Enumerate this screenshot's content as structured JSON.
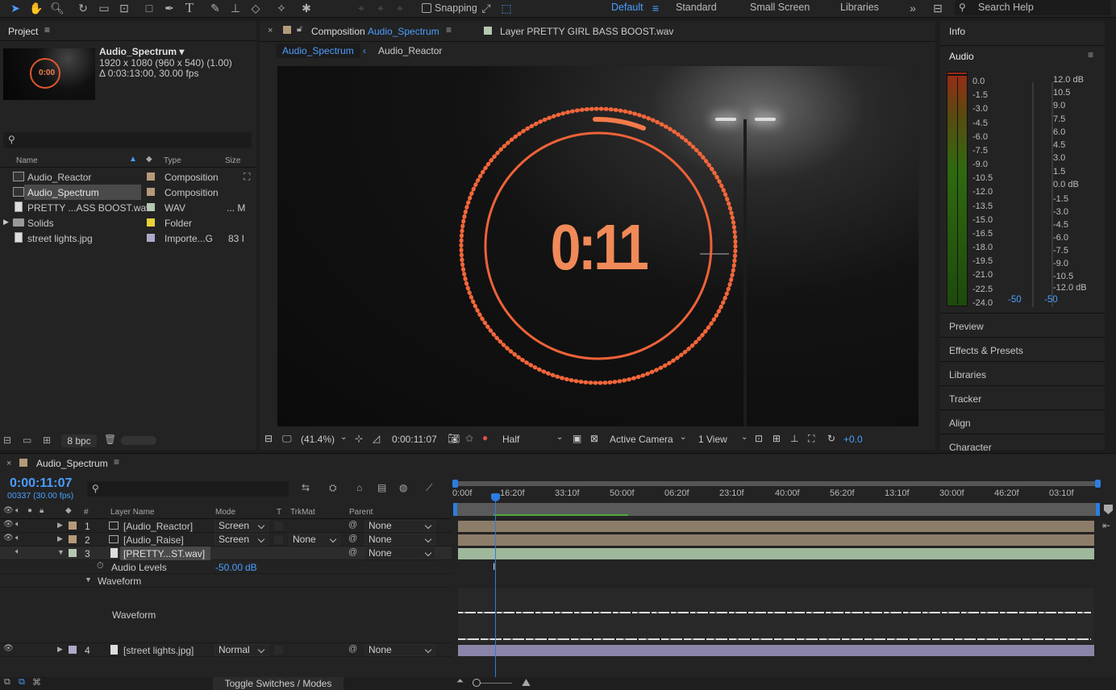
{
  "toolbar": {
    "snapping_label": "Snapping",
    "workspaces": [
      "Default",
      "Standard",
      "Small Screen",
      "Libraries"
    ],
    "active_workspace": "Default",
    "search_placeholder": "Search Help"
  },
  "project": {
    "title": "Project",
    "comp_name": "Audio_Spectrum ▾",
    "comp_res": "1920 x 1080  (960 x 540) (1.00)",
    "comp_dur": "Δ 0:03:13:00, 30.00 fps",
    "thumb_time": "0:00",
    "columns": {
      "name": "Name",
      "type": "Type",
      "size": "Size"
    },
    "items": [
      {
        "name": "Audio_Reactor",
        "type": "Composition",
        "size": "",
        "color": "#b59a7a"
      },
      {
        "name": "Audio_Spectrum",
        "type": "Composition",
        "size": "",
        "color": "#b59a7a"
      },
      {
        "name": "PRETTY ...ASS BOOST.wav",
        "type": "WAV",
        "size": "... M",
        "color": "#b5c8b0"
      },
      {
        "name": "Solids",
        "type": "Folder",
        "size": "",
        "color": "#e8d23a"
      },
      {
        "name": "street lights.jpg",
        "type": "Importe...G",
        "size": "83 I",
        "color": "#b0a8c8"
      }
    ],
    "bpc": "8 bpc"
  },
  "comp_viewer": {
    "tab_prefix": "Composition",
    "tab_name": "Audio_Spectrum",
    "layer_tab": "Layer PRETTY GIRL BASS BOOST.wav",
    "breadcrumb": [
      "Audio_Spectrum",
      "Audio_Reactor"
    ],
    "timer": "0:11",
    "footer": {
      "zoom": "(41.4%)",
      "timecode": "0:00:11:07",
      "resolution": "Half",
      "camera": "Active Camera",
      "views": "1 View",
      "exposure": "+0.0"
    }
  },
  "right_panel": {
    "info": "Info",
    "audio": "Audio",
    "left_scale": [
      "0.0",
      "-1.5",
      "-3.0",
      "-4.5",
      "-6.0",
      "-7.5",
      "-9.0",
      "-10.5",
      "-12.0",
      "-13.5",
      "-15.0",
      "-16.5",
      "-18.0",
      "-19.5",
      "-21.0",
      "-22.5",
      "-24.0"
    ],
    "right_scale": [
      "12.0 dB",
      "10.5",
      "9.0",
      "7.5",
      "6.0",
      "4.5",
      "3.0",
      "1.5",
      "0.0 dB",
      "-1.5",
      "-3.0",
      "-4.5",
      "-6.0",
      "-7.5",
      "-9.0",
      "-10.5",
      "-12.0 dB"
    ],
    "level_left": "-50",
    "level_right": "-50",
    "sections": [
      "Preview",
      "Effects & Presets",
      "Libraries",
      "Tracker",
      "Align",
      "Character"
    ]
  },
  "timeline": {
    "tab": "Audio_Spectrum",
    "timecode": "0:00:11:07",
    "frames": "00337 (30.00 fps)",
    "columns": {
      "num": "#",
      "layer_name": "Layer Name",
      "mode": "Mode",
      "t": "T",
      "trkmat": "TrkMat",
      "parent": "Parent"
    },
    "layers": [
      {
        "num": "1",
        "name": "[Audio_Reactor]",
        "mode": "Screen",
        "trkmat": "",
        "parent": "None"
      },
      {
        "num": "2",
        "name": "[Audio_Raise]",
        "mode": "Screen",
        "trkmat": "None",
        "parent": "None"
      },
      {
        "num": "3",
        "name": "[PRETTY...ST.wav]",
        "mode": "",
        "trkmat": "",
        "parent": "None"
      },
      {
        "num": "4",
        "name": "[street lights.jpg]",
        "mode": "Normal",
        "trkmat": "",
        "parent": "None"
      }
    ],
    "audio_levels_label": "Audio Levels",
    "audio_levels_value": "-50.00",
    "audio_levels_unit": "dB",
    "waveform_group": "Waveform",
    "waveform_label": "Waveform",
    "ruler": [
      "0:00f",
      "16:20f",
      "33:10f",
      "50:00f",
      "06:20f",
      "23:10f",
      "40:00f",
      "56:20f",
      "13:10f",
      "30:00f",
      "46:20f",
      "03:10f"
    ],
    "toggle_label": "Toggle Switches / Modes"
  }
}
